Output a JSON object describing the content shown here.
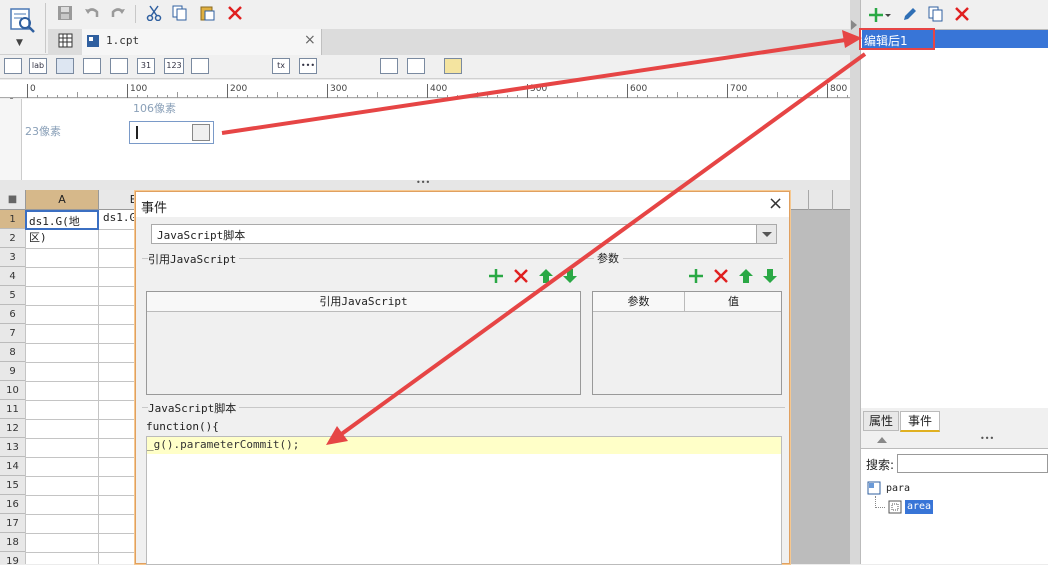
{
  "toolbar": {
    "menu_arrow": "▼"
  },
  "tab": {
    "label": "1.cpt",
    "close": "×"
  },
  "widget_bar": {
    "items": [
      "lab",
      "31",
      "123",
      "tx",
      "•••"
    ]
  },
  "ruler": {
    "ticks": [
      "0",
      "100",
      "200",
      "300",
      "400",
      "500",
      "600",
      "700",
      "800"
    ],
    "vertical_tick": "0",
    "width_label": "106像素",
    "height_label": "23像素"
  },
  "splitter": "•••",
  "sheet": {
    "col_headers": [
      "A",
      "B"
    ],
    "rows": [
      "1",
      "2",
      "3",
      "4",
      "5",
      "6",
      "7",
      "8",
      "9",
      "10",
      "11",
      "12",
      "13",
      "14",
      "15",
      "16",
      "17",
      "18",
      "19"
    ],
    "cell_a1": "ds1.G(地区)",
    "cell_b1": "ds1.G"
  },
  "dialog": {
    "title": "事件",
    "close": "×",
    "event_type": "JavaScript脚本",
    "ref_group_label": "引用JavaScript",
    "ref_column": "引用JavaScript",
    "params_label": "参数",
    "params_columns": [
      "参数",
      "值"
    ],
    "script_group_label": "JavaScript脚本",
    "script_line1": "function(){",
    "script_line2": "_g().parameterCommit();"
  },
  "right_panel": {
    "event_item": "编辑后1",
    "tabs": [
      "属性",
      "事件"
    ],
    "search_label": "搜索:",
    "search_value": "",
    "tree_root": "para",
    "tree_child": "area",
    "splitter": "•••"
  },
  "colors": {
    "accent": "#3875d7",
    "arrow": "#e64545",
    "highlight": "#ffffc8",
    "add": "#2aa845",
    "delete": "#e02020"
  }
}
